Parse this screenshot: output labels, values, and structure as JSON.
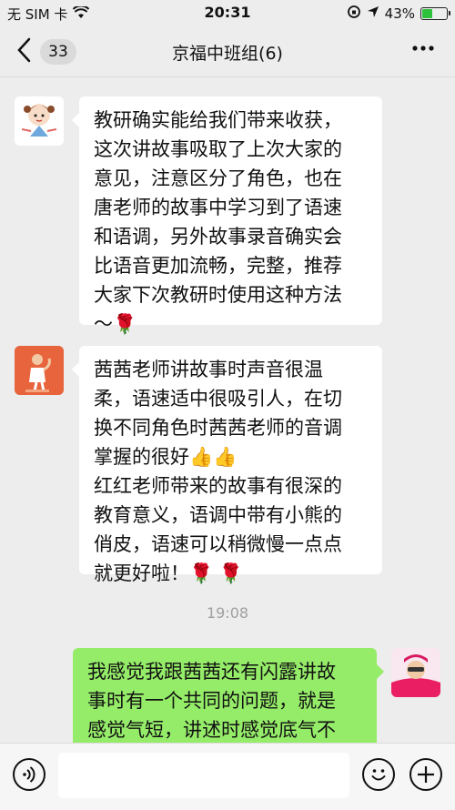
{
  "status": {
    "carrier": "无 SIM 卡",
    "time": "20:31",
    "battery_text": "43%",
    "battery_level": 0.43,
    "battery_color": "#2ec13b"
  },
  "header": {
    "unread_count": "33",
    "title": "京福中班组(6)"
  },
  "messages": [
    {
      "side": "left",
      "text": "教研确实能给我们带来收获，\n这次讲故事吸取了上次大家的\n意见，注意区分了角色，也在\n唐老师的故事中学习到了语速\n和语调，另外故事录音确实会\n比语音更加流畅，完整，推荐\n大家下次教研时使用这种方法\n～🌹"
    },
    {
      "side": "left",
      "text": "茜茜老师讲故事时声音很温\n柔，语速适中很吸引人，在切\n换不同角色时茜茜老师的音调\n掌握的很好👍👍\n红红老师带来的故事有很深的\n教育意义，语调中带有小熊的\n俏皮，语速可以稍微慢一点点\n就更好啦！🌹 🌹"
    },
    {
      "side": "right",
      "text": "我感觉我跟茜茜还有闪露讲故\n事时有一个共同的问题，就是\n感觉气短，讲述时感觉底气不\n足，讲快了后，有另语言，有"
    }
  ],
  "timestamp": "19:08",
  "colors": {
    "background": "#ededed",
    "outgoing_bubble": "#95ec69",
    "incoming_bubble": "#ffffff"
  }
}
